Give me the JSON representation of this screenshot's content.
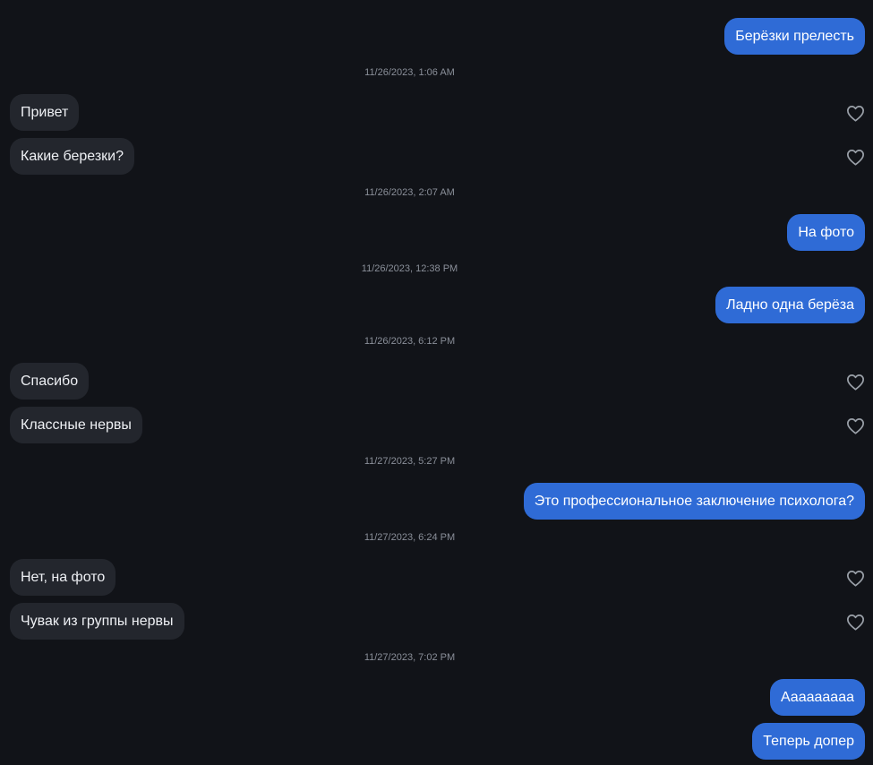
{
  "messages": [
    {
      "type": "out",
      "text": "Берёзки прелесть"
    },
    {
      "type": "timestamp",
      "text": "11/26/2023, 1:06 AM"
    },
    {
      "type": "in",
      "text": "Привет"
    },
    {
      "type": "in",
      "text": "Какие березки?"
    },
    {
      "type": "timestamp",
      "text": "11/26/2023, 2:07 AM"
    },
    {
      "type": "out",
      "text": "На фото"
    },
    {
      "type": "timestamp",
      "text": "11/26/2023, 12:38 PM"
    },
    {
      "type": "out",
      "text": "Ладно одна берёза"
    },
    {
      "type": "timestamp",
      "text": "11/26/2023, 6:12 PM"
    },
    {
      "type": "in",
      "text": "Спасибо"
    },
    {
      "type": "in",
      "text": "Классные нервы"
    },
    {
      "type": "timestamp",
      "text": "11/27/2023, 5:27 PM"
    },
    {
      "type": "out",
      "text": "Это профессиональное заключение психолога?"
    },
    {
      "type": "timestamp",
      "text": "11/27/2023, 6:24 PM"
    },
    {
      "type": "in",
      "text": "Нет, на фото"
    },
    {
      "type": "in",
      "text": "Чувак из группы нервы"
    },
    {
      "type": "timestamp",
      "text": "11/27/2023, 7:02 PM"
    },
    {
      "type": "out",
      "text": "Ааааааааа"
    },
    {
      "type": "out",
      "text": "Теперь допер"
    }
  ],
  "icons": {
    "like": "heart-outline-icon"
  },
  "colors": {
    "background": "#111318",
    "outgoing_bubble": "#2f6bd6",
    "incoming_bubble": "#23262d",
    "timestamp_text": "#8a8f99",
    "heart_stroke": "#9aa0a8"
  }
}
